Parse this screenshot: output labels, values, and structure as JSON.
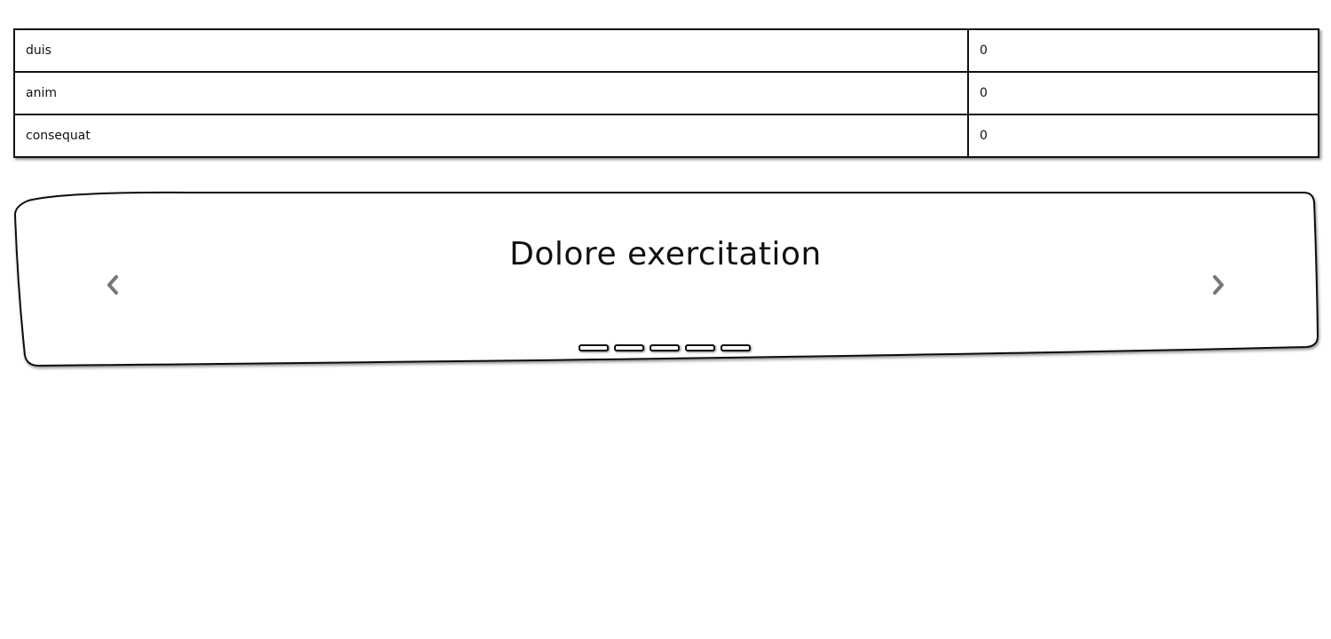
{
  "table": {
    "rows": [
      {
        "name": "duis",
        "value": "0"
      },
      {
        "name": "anim",
        "value": "0"
      },
      {
        "name": "consequat",
        "value": "0"
      }
    ]
  },
  "carousel": {
    "title": "Dolore exercitation",
    "prev_icon": "chevron-left-icon",
    "next_icon": "chevron-right-icon",
    "indicator_count": 5,
    "arrow_color": "#777777",
    "border_color": "#111111"
  }
}
